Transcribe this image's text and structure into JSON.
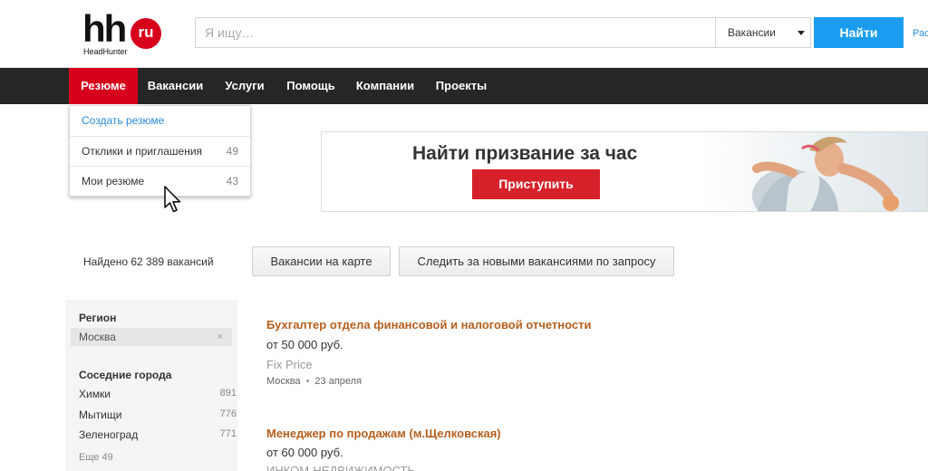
{
  "header": {
    "logo_main": "hh",
    "logo_badge": "ru",
    "logo_sub": "HeadHunter",
    "search_placeholder": "Я ищу…",
    "search_scope": "Вакансии",
    "find_label": "Найти",
    "cut_link": "Рас"
  },
  "nav": {
    "items": [
      {
        "label": "Резюме",
        "active": true
      },
      {
        "label": "Вакансии"
      },
      {
        "label": "Услуги"
      },
      {
        "label": "Помощь"
      },
      {
        "label": "Компании"
      },
      {
        "label": "Проекты"
      }
    ]
  },
  "dropdown": {
    "items": [
      {
        "label": "Создать резюме",
        "count": ""
      },
      {
        "label": "Отклики и приглашения",
        "count": "49"
      },
      {
        "label": "Мои резюме",
        "count": "43"
      }
    ]
  },
  "banner": {
    "title": "Найти призвание за час",
    "button_label": "Приступить"
  },
  "results": {
    "found_text": "Найдено 62 389 вакансий",
    "map_button": "Вакансии на карте",
    "follow_button": "Следить за новыми вакансиями по запросу"
  },
  "sidebar": {
    "region_heading": "Регион",
    "region_value": "Москва",
    "remove_glyph": "×",
    "nearby_heading": "Соседние города",
    "cities": [
      {
        "name": "Химки",
        "count": "891"
      },
      {
        "name": "Мытищи",
        "count": "776"
      },
      {
        "name": "Зеленоград",
        "count": "771"
      }
    ],
    "more": "Еще 49"
  },
  "vacancies": [
    {
      "title": "Бухгалтер отдела финансовой и налоговой отчетности",
      "salary": "от 50 000 руб.",
      "company": "Fix Price",
      "city": "Москва",
      "date": "23 апреля"
    },
    {
      "title": "Менеджер по продажам (м.Щелковская)",
      "salary": "от 60 000 руб.",
      "company": "ИНКОМ-НЕДВИЖИМОСТЬ"
    }
  ],
  "colors": {
    "brand_red": "#d6001c",
    "nav_bg": "#262626",
    "find_blue": "#1a9df0",
    "link_blue": "#2a8bd6",
    "vacancy_title": "#b65f1e"
  }
}
